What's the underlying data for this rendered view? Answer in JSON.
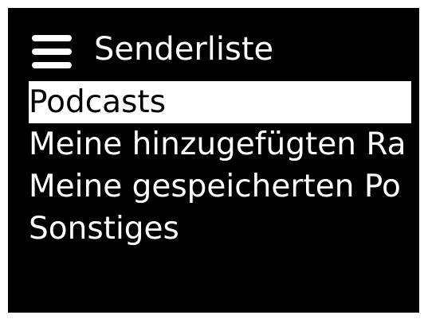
{
  "header": {
    "menu_icon": "hamburger-menu-icon",
    "title": "Senderliste"
  },
  "list": {
    "selected_index": 0,
    "items": [
      {
        "label": "Podcasts"
      },
      {
        "label": "Meine hinzugefügten Ra"
      },
      {
        "label": "Meine gespeicherten Po"
      },
      {
        "label": "Sonstiges"
      }
    ]
  },
  "colors": {
    "background": "#000000",
    "text": "#ffffff",
    "highlight": "#ffffff",
    "highlight_text": "#000000"
  }
}
